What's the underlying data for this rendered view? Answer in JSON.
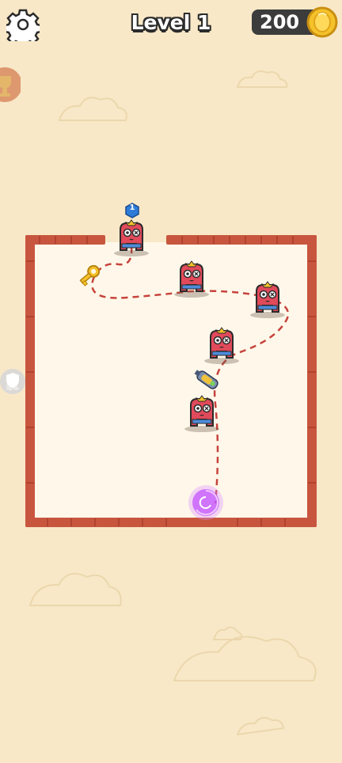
{
  "hud": {
    "settings_icon": "gear-icon",
    "level_title": "Level 1",
    "coins": "200",
    "coin_icon": "gold-coin-icon"
  },
  "side_buttons": {
    "left_top": "trophy-icon",
    "left_middle": "shield-icon",
    "left_middle_label": "隐私"
  },
  "game": {
    "player_level_badge": "1",
    "key_icon": "golden-key-icon",
    "weapon_icon": "blaster-gun-icon",
    "portal_icon": "purple-portal-icon",
    "enemy_count": 5,
    "colors": {
      "background": "#f8e8c7",
      "wall": "#c8563f",
      "wall_dark": "#a83d2b",
      "path": "#c6433c",
      "enemy_body": "#e04a5a",
      "portal": "#c04bff",
      "coin": "#f5c22a"
    }
  }
}
